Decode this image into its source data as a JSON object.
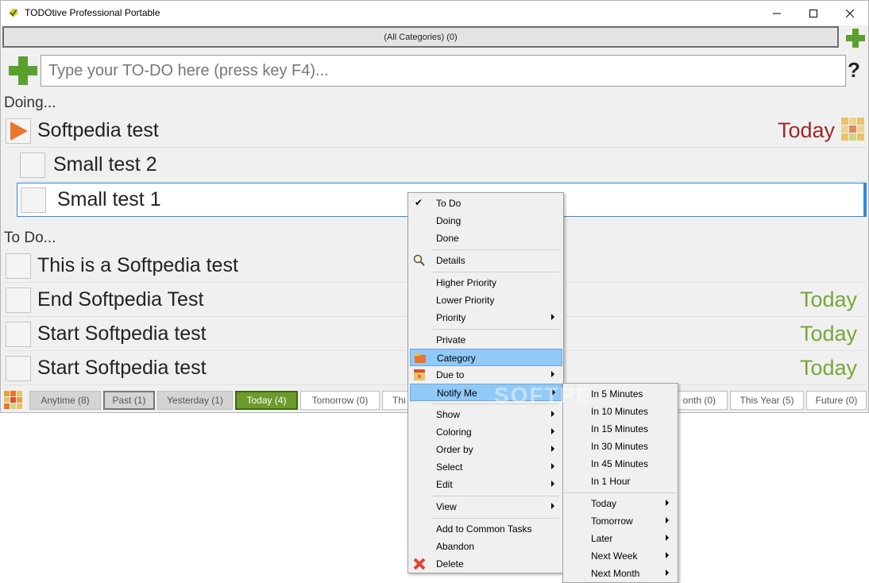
{
  "window": {
    "title": "TODOtive Professional Portable"
  },
  "category_bar": {
    "label": "(All Categories) (0)"
  },
  "input": {
    "placeholder": "Type your TO-DO here (press key F4)..."
  },
  "help": {
    "label": "?"
  },
  "sections": {
    "doing": "Doing...",
    "todo": "To Do..."
  },
  "doing_items": [
    {
      "text": "Softpedia test",
      "due": "Today",
      "due_color": "#a0282a"
    },
    {
      "text": "Small test 2"
    },
    {
      "text": "Small test 1"
    }
  ],
  "todo_items": [
    {
      "text": "This is a Softpedia test"
    },
    {
      "text": "End Softpedia Test",
      "due": "Today",
      "due_color": "#78a638"
    },
    {
      "text": "Start Softpedia test",
      "due": "Today",
      "due_color": "#78a638"
    },
    {
      "text": "Start Softpedia test",
      "due": "Today",
      "due_color": "#78a638"
    }
  ],
  "filters": [
    "Anytime (8)",
    "Past (1)",
    "Yesterday (1)",
    "Today (4)",
    "Tomorrow (0)",
    "Thi",
    "onth (0)",
    "This Year (5)",
    "Future (0)"
  ],
  "context_menu": {
    "items": [
      "To Do",
      "Doing",
      "Done",
      "Details",
      "Higher Priority",
      "Lower Priority",
      "Priority",
      "Private",
      "Category",
      "Due to",
      "Notify Me",
      "Show",
      "Coloring",
      "Order by",
      "Select",
      "Edit",
      "View",
      "Add to Common Tasks",
      "Abandon",
      "Delete"
    ],
    "checked_item": "To Do",
    "check_mark": "✔"
  },
  "submenu": {
    "items": [
      "In 5 Minutes",
      "In 10 Minutes",
      "In 15 Minutes",
      "In 30 Minutes",
      "In 45 Minutes",
      "In 1 Hour",
      "Today",
      "Tomorrow",
      "Later",
      "Next Week",
      "Next Month"
    ]
  },
  "watermark": "SOFTPE",
  "colors": {
    "accent_green": "#5aa02c",
    "play_orange": "#e8762d",
    "highlight": "#91c9f7"
  }
}
